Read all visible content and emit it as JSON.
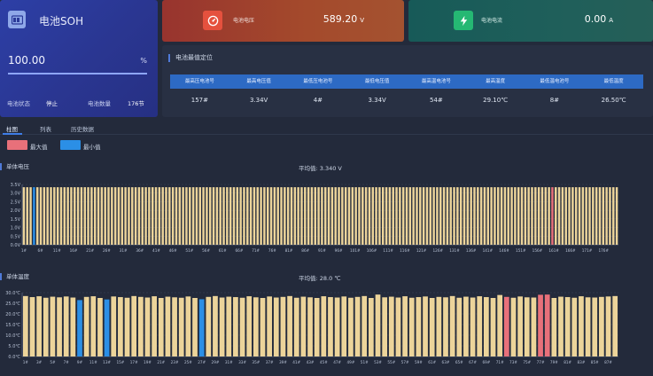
{
  "soh": {
    "title": "电池SOH",
    "value": "100.00",
    "percent": 100,
    "unit": "%",
    "status_label": "电池状态",
    "status_value": "停止",
    "count_label": "电池数量",
    "count_value": "176节"
  },
  "voltage_card": {
    "label": "电池电压",
    "value": "589.20",
    "unit": "V"
  },
  "current_card": {
    "label": "电池电流",
    "value": "0.00",
    "unit": "A"
  },
  "extreme": {
    "title": "电池最值定位",
    "headers": [
      "最高压电池号",
      "最高电压值",
      "最低压电池号",
      "最低电压值",
      "最高温电池号",
      "最高温度",
      "最低温电池号",
      "最低温度"
    ],
    "values": [
      "157#",
      "3.34V",
      "4#",
      "3.34V",
      "54#",
      "29.10℃",
      "8#",
      "26.50℃"
    ]
  },
  "tabs": [
    {
      "label": "柱图",
      "active": true
    },
    {
      "label": "列表",
      "active": false
    },
    {
      "label": "历史数据",
      "active": false
    }
  ],
  "legend": {
    "max_label": "最大值",
    "max_color": "#e8707a",
    "min_label": "最小值",
    "min_color": "#2b8fe6"
  },
  "colors": {
    "bar": "#ecd49a",
    "max": "#e8707a",
    "min": "#2b8fe6"
  },
  "chart_data": [
    {
      "type": "bar",
      "title": "单体电压",
      "average_text": "平均值: 3.340 V",
      "ylim": [
        0,
        3.5
      ],
      "yticks": [
        "0.0V",
        "0.5V",
        "1.0V",
        "1.5V",
        "2.0V",
        "2.5V",
        "3.0V",
        "3.5V"
      ],
      "ytick_values": [
        0,
        0.5,
        1.0,
        1.5,
        2.0,
        2.5,
        3.0,
        3.5
      ],
      "count": 176,
      "base_value": 3.34,
      "highlight_max": [
        157
      ],
      "highlight_min": [
        4
      ],
      "xticks": [
        "1#",
        "6#",
        "11#",
        "16#",
        "21#",
        "26#",
        "31#",
        "36#",
        "41#",
        "46#",
        "51#",
        "56#",
        "61#",
        "66#",
        "71#",
        "76#",
        "81#",
        "86#",
        "91#",
        "96#",
        "101#",
        "106#",
        "111#",
        "116#",
        "121#",
        "126#",
        "131#",
        "136#",
        "141#",
        "146#",
        "151#",
        "156#",
        "161#",
        "166#",
        "171#",
        "176#"
      ]
    },
    {
      "type": "bar",
      "title": "单体温度",
      "average_text": "平均值: 28.0 ℃",
      "ylim": [
        0,
        30
      ],
      "yticks": [
        "0.0℃",
        "5.0℃",
        "10.0℃",
        "15.0℃",
        "20.0℃",
        "25.0℃",
        "30.0℃"
      ],
      "ytick_values": [
        0,
        5,
        10,
        15,
        20,
        25,
        30
      ],
      "count": 88,
      "values": [
        28.4,
        27.9,
        28.3,
        27.6,
        28.1,
        27.8,
        28.2,
        27.7,
        26.5,
        28.0,
        28.3,
        27.5,
        26.8,
        28.2,
        27.9,
        27.6,
        28.4,
        28.0,
        27.7,
        28.3,
        27.5,
        28.1,
        27.8,
        27.6,
        28.2,
        27.5,
        26.9,
        28.0,
        28.4,
        27.7,
        28.1,
        27.9,
        27.6,
        28.3,
        27.8,
        27.5,
        28.2,
        27.7,
        28.0,
        28.4,
        27.6,
        28.1,
        27.8,
        27.5,
        28.3,
        27.9,
        27.7,
        28.2,
        27.6,
        28.0,
        28.4,
        27.5,
        29.1,
        27.8,
        28.1,
        27.7,
        28.3,
        27.6,
        27.9,
        28.2,
        27.5,
        28.0,
        27.8,
        28.4,
        27.6,
        28.1,
        27.7,
        28.3,
        27.9,
        27.5,
        28.9,
        28.0,
        27.6,
        28.2,
        27.8,
        27.7,
        29.0,
        29.1,
        27.5,
        28.1,
        27.9,
        27.6,
        28.3,
        27.8,
        27.7,
        28.0,
        28.2,
        28.4
      ],
      "highlight_max": [
        72,
        77,
        78
      ],
      "highlight_min": [
        9,
        13,
        27
      ],
      "xticks": [
        "1#",
        "3#",
        "5#",
        "7#",
        "9#",
        "11#",
        "13#",
        "15#",
        "17#",
        "19#",
        "21#",
        "23#",
        "25#",
        "27#",
        "29#",
        "31#",
        "33#",
        "35#",
        "37#",
        "39#",
        "41#",
        "43#",
        "45#",
        "47#",
        "49#",
        "51#",
        "53#",
        "55#",
        "57#",
        "59#",
        "61#",
        "63#",
        "65#",
        "67#",
        "69#",
        "71#",
        "73#",
        "75#",
        "77#",
        "79#",
        "81#",
        "83#",
        "85#",
        "87#"
      ]
    }
  ]
}
